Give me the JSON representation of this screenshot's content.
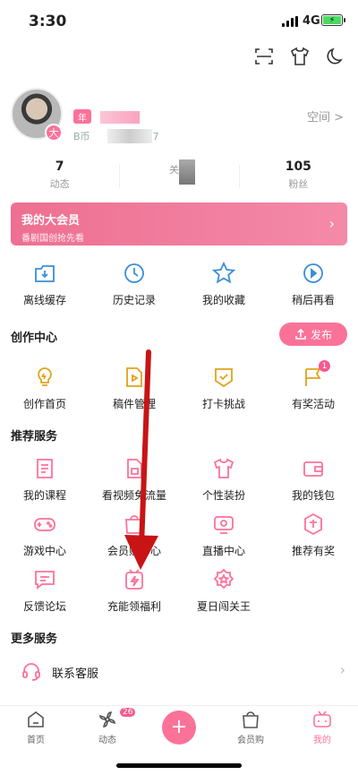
{
  "status": {
    "time": "3:30",
    "network": "4G"
  },
  "top_icons": [
    "scan-icon",
    "tshirt-icon",
    "moon-icon"
  ],
  "profile": {
    "avatar_badge": "大",
    "vip_tag": "年",
    "uname_partial": "B币",
    "uname_tail": "37",
    "space_label": "空间 >"
  },
  "stats": [
    {
      "num": "7",
      "label": "动态"
    },
    {
      "num": "",
      "label": "关注"
    },
    {
      "num": "105",
      "label": "粉丝"
    }
  ],
  "vip": {
    "title": "我的大会员",
    "subtitle": "番剧国创抢先看",
    "chevron": "›"
  },
  "quick": [
    {
      "label": "离线缓存",
      "icon": "download-icon"
    },
    {
      "label": "历史记录",
      "icon": "history-icon"
    },
    {
      "label": "我的收藏",
      "icon": "star-icon"
    },
    {
      "label": "稍后再看",
      "icon": "watch-later-icon"
    }
  ],
  "creation": {
    "title": "创作中心",
    "publish_label": "发布",
    "items": [
      {
        "label": "创作首页",
        "icon": "bulb-icon"
      },
      {
        "label": "稿件管理",
        "icon": "manuscript-icon"
      },
      {
        "label": "打卡挑战",
        "icon": "checkin-icon"
      },
      {
        "label": "有奖活动",
        "icon": "flag-icon",
        "badge": "1"
      }
    ]
  },
  "recommend": {
    "title": "推荐服务",
    "rows": [
      [
        {
          "label": "我的课程",
          "icon": "course-icon"
        },
        {
          "label": "看视频免流量",
          "icon": "sim-icon"
        },
        {
          "label": "个性装扮",
          "icon": "tshirt-icon"
        },
        {
          "label": "我的钱包",
          "icon": "wallet-icon"
        }
      ],
      [
        {
          "label": "游戏中心",
          "icon": "gamepad-icon"
        },
        {
          "label": "会员购中心",
          "icon": "shopping-bag-icon"
        },
        {
          "label": "直播中心",
          "icon": "live-icon"
        },
        {
          "label": "推荐有奖",
          "icon": "reward-icon"
        }
      ],
      [
        {
          "label": "反馈论坛",
          "icon": "feedback-icon"
        },
        {
          "label": "充能领福利",
          "icon": "charge-icon"
        },
        {
          "label": "夏日闯关王",
          "icon": "medal-icon"
        },
        {
          "label": "",
          "icon": ""
        }
      ]
    ]
  },
  "more": {
    "title": "更多服务",
    "contact_label": "联系客服",
    "chevron": "›"
  },
  "tabbar": [
    {
      "label": "首页",
      "icon": "home-icon"
    },
    {
      "label": "动态",
      "icon": "fan-icon",
      "badge": "26"
    },
    {
      "label": "",
      "icon": "plus-icon"
    },
    {
      "label": "会员购",
      "icon": "bag-icon"
    },
    {
      "label": "我的",
      "icon": "tv-icon",
      "active": true
    }
  ],
  "colors": {
    "accent": "#fb7299",
    "icon_blue": "#3b8ed8",
    "icon_gold": "#e0a31a",
    "annotation_arrow": "#c81414"
  }
}
